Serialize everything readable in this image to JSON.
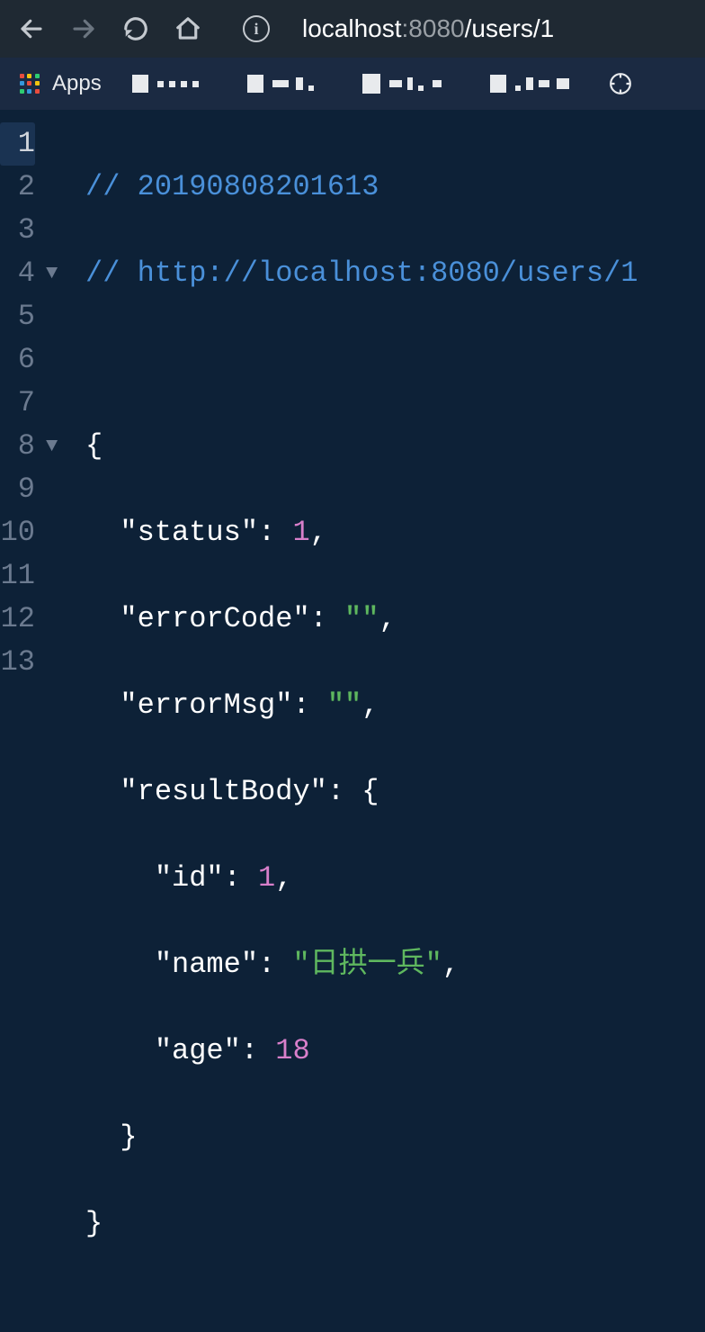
{
  "toolbar": {
    "url_host": "localhost",
    "url_port": ":8080",
    "url_path": "/users/1"
  },
  "bookmarks": {
    "apps_label": "Apps"
  },
  "code": {
    "line_numbers": [
      "1",
      "2",
      "3",
      "4",
      "5",
      "6",
      "7",
      "8",
      "9",
      "10",
      "11",
      "12",
      "13"
    ],
    "fold_markers": {
      "4": "▼",
      "8": "▼"
    },
    "comment1": "// 20190808201613",
    "comment2": "// http://localhost:8080/users/1",
    "brace_open": "{",
    "brace_close": "}",
    "key_status": "\"status\"",
    "val_status": "1",
    "key_errorCode": "\"errorCode\"",
    "val_errorCode_q1": "\"",
    "val_errorCode_q2": "\"",
    "key_errorMsg": "\"errorMsg\"",
    "val_errorMsg_q1": "\"",
    "val_errorMsg_q2": "\"",
    "key_resultBody": "\"resultBody\"",
    "key_id": "\"id\"",
    "val_id": "1",
    "key_name": "\"name\"",
    "val_name": "\"日拱一兵\"",
    "key_age": "\"age\"",
    "val_age": "18",
    "colon": ":",
    "comma": ","
  }
}
